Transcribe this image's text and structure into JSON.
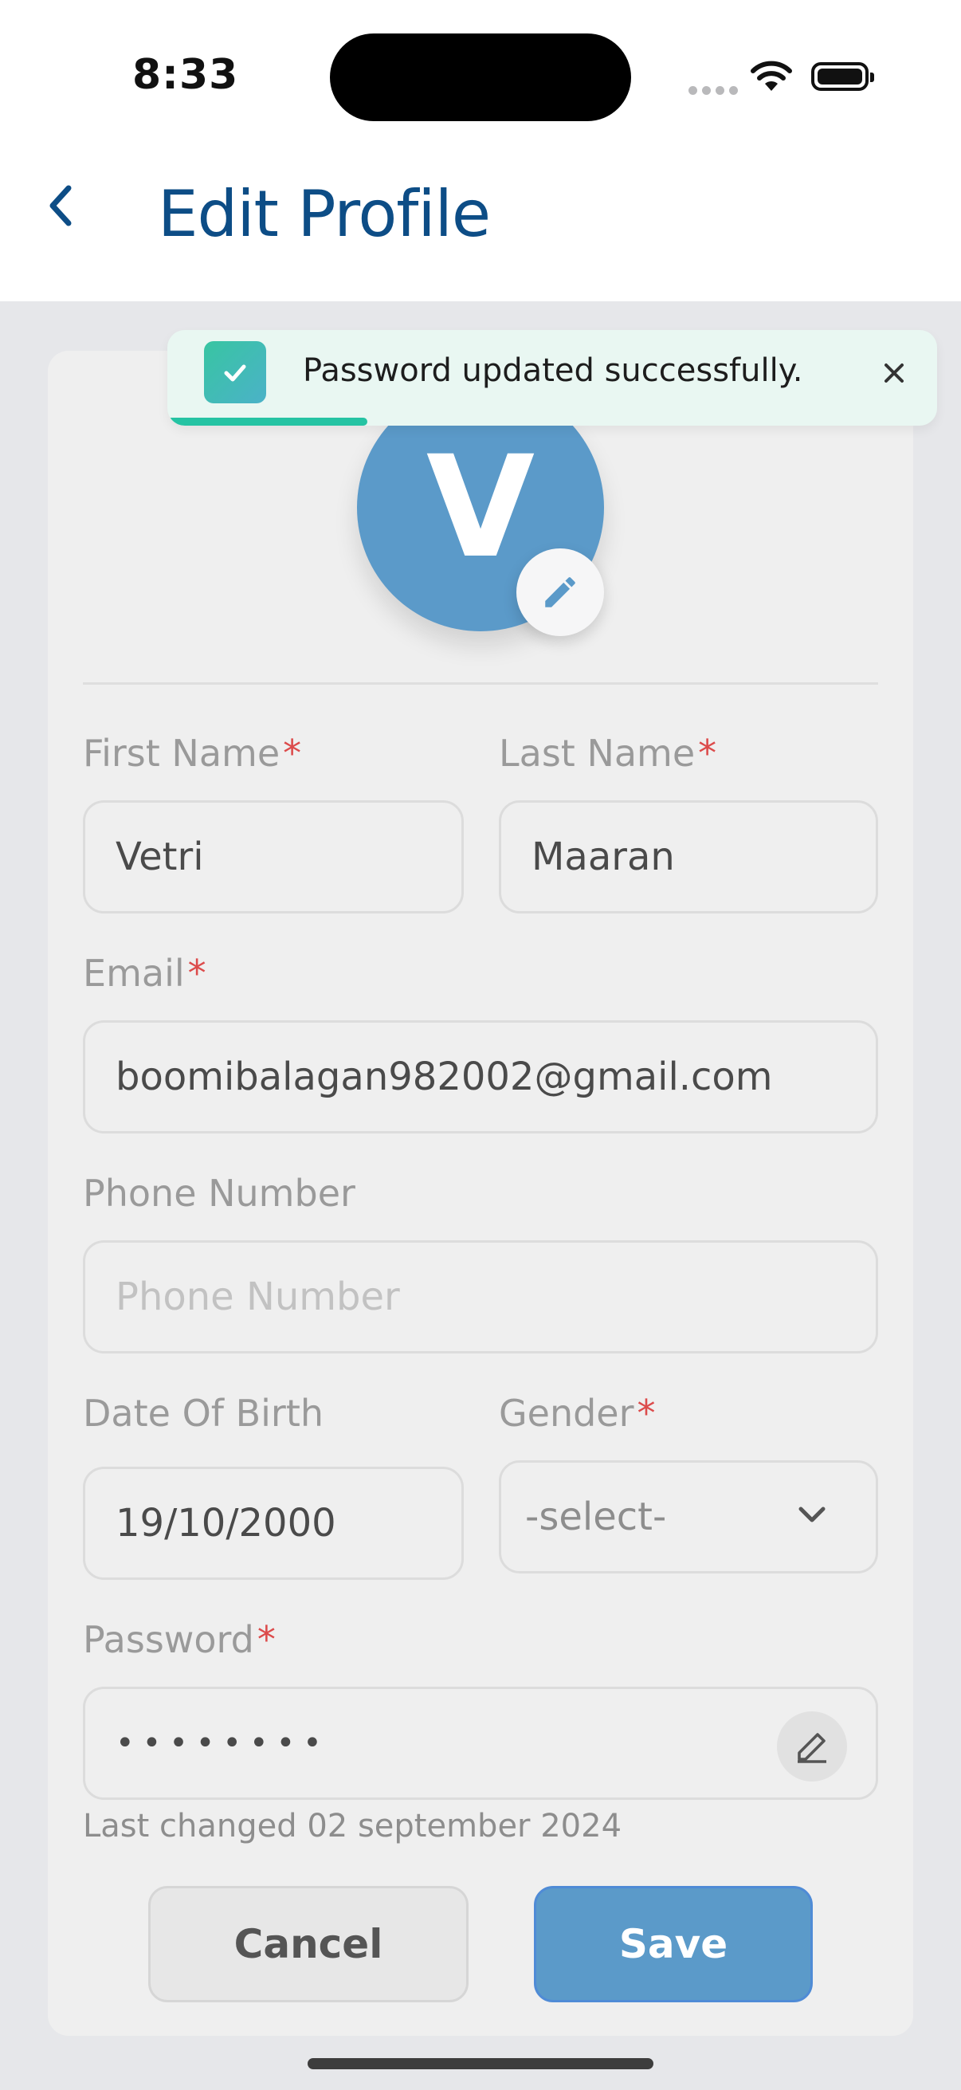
{
  "status_bar": {
    "time": "8:33"
  },
  "header": {
    "title": "Edit Profile"
  },
  "avatar": {
    "initial": "V"
  },
  "form": {
    "first_name": {
      "label": "First Name",
      "required": "*",
      "value": "Vetri"
    },
    "last_name": {
      "label": "Last Name",
      "required": "*",
      "value": "Maaran"
    },
    "email": {
      "label": "Email",
      "required": "*",
      "value": "boomibalagan982002@gmail.com"
    },
    "phone": {
      "label": "Phone Number",
      "placeholder": "Phone Number"
    },
    "dob": {
      "label": "Date Of Birth",
      "value": "19/10/2000"
    },
    "gender": {
      "label": "Gender",
      "required": "*",
      "value": "-select-"
    },
    "password": {
      "label": "Password",
      "required": "*",
      "value": "••••••••",
      "hint": "Last changed 02 september 2024"
    }
  },
  "buttons": {
    "cancel": "Cancel",
    "save": "Save"
  },
  "toast": {
    "message": "Password updated successfully.",
    "progress": 0.26
  },
  "colors": {
    "accent": "#5b9ac9",
    "title": "#0d4d86",
    "required": "#dc4b4b",
    "toast_bg": "#e9f7f2",
    "toast_progress": "#25c3a3"
  },
  "icons": [
    "back-chevron-icon",
    "pencil-icon",
    "check-icon",
    "close-icon",
    "chevron-down-icon",
    "edit-pencil-icon",
    "wifi-icon",
    "battery-icon"
  ]
}
